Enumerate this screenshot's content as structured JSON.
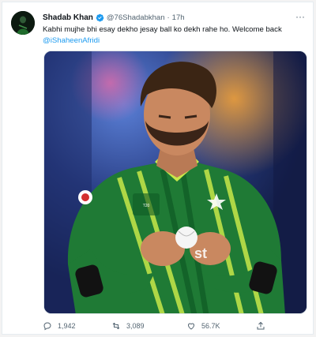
{
  "tweet": {
    "author_name": "Shadab Khan",
    "author_handle": "@76Shadabkhan",
    "separator": "·",
    "time": "17h",
    "more_label": "···",
    "text": "Kabhi mujhe bhi esay dekho jesay ball ko dekh rahe ho. Welcome back",
    "mention": "@iShaheenAfridi",
    "verified_icon": "verified-badge-icon",
    "accent_color": "#1d9bf0"
  },
  "media": {
    "jersey_text": "st",
    "badge_text": "MEN'S T20 WORLD CUP"
  },
  "actions": {
    "reply_count": "1,942",
    "retweet_count": "3,089",
    "like_count": "56.7K"
  }
}
